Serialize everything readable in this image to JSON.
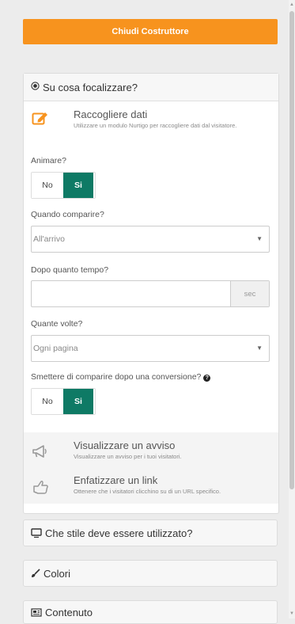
{
  "header": {
    "close_builder_label": "Chiudi Costruttore"
  },
  "focus_panel": {
    "title": "Su cosa focalizzare?",
    "collect_option": {
      "title": "Raccogliere dati",
      "description": "Utilizzare un modulo Nurtigo per raccogliere dati dal visitatore."
    },
    "animate": {
      "label": "Animare?",
      "no": "No",
      "yes": "Si",
      "selected": "Si"
    },
    "when_appear": {
      "label": "Quando comparire?",
      "value": "All'arrivo"
    },
    "after_time": {
      "label": "Dopo quanto tempo?",
      "value": "",
      "unit": "sec"
    },
    "how_many": {
      "label": "Quante volte?",
      "value": "Ogni pagina"
    },
    "stop_after_conversion": {
      "label": "Smettere di comparire dopo una conversione?",
      "no": "No",
      "yes": "Si",
      "selected": "Si"
    },
    "notice_option": {
      "title": "Visualizzare un avviso",
      "description": "Visualizzare un avviso per i tuoi visitatori."
    },
    "link_option": {
      "title": "Enfatizzare un link",
      "description": "Ottenere che i visitatori clicchino su di un URL specifico."
    }
  },
  "style_panel": {
    "title": "Che stile deve essere utilizzato?"
  },
  "colors_panel": {
    "title": "Colori"
  },
  "content_panel": {
    "title": "Contenuto"
  },
  "colors": {
    "accent": "#f7931e",
    "toggle_active": "#0e7a65",
    "icon_orange": "#f7931e"
  },
  "icons": {
    "focus": "target-icon",
    "collect": "edit-icon",
    "notice": "megaphone-icon",
    "link": "hand-pointer-icon",
    "style": "monitor-icon",
    "colors": "brush-icon",
    "content": "newspaper-icon",
    "help": "question-icon",
    "caret": "caret-down-icon"
  }
}
